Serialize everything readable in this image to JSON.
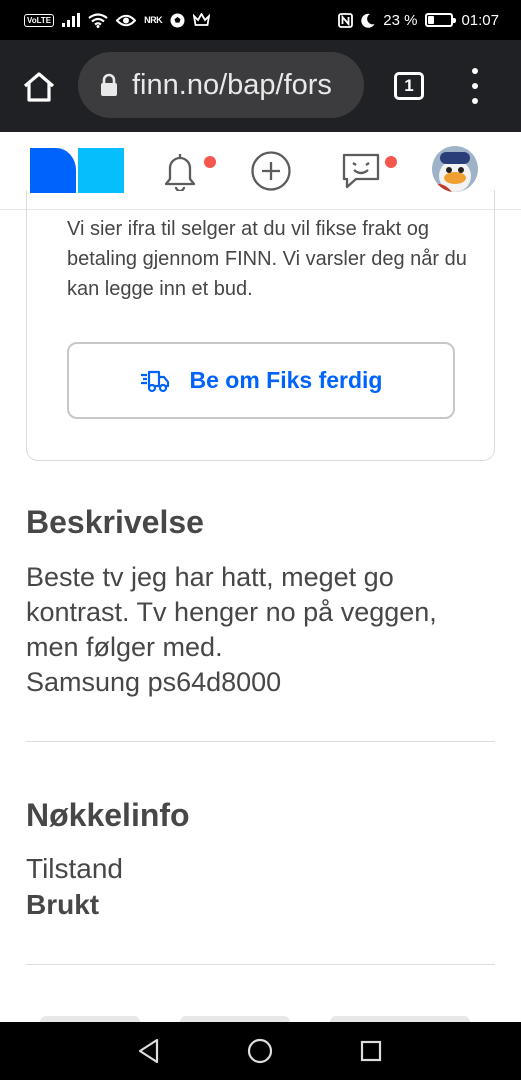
{
  "status_bar": {
    "volte": "VoLTE",
    "nrk": "NRK",
    "battery_percent": "23 %",
    "battery_level": 0.23,
    "time": "01:07"
  },
  "browser": {
    "url": "finn.no/bap/fors",
    "tab_count": "1"
  },
  "site_header": {
    "notifications_unread": true,
    "messages_unread": true
  },
  "fiks_card": {
    "text": "Vi sier ifra til selger at du vil fikse frakt og betaling gjennom FINN. Vi varsler deg når du kan legge inn et bud.",
    "button_label": "Be om Fiks ferdig"
  },
  "description": {
    "title": "Beskrivelse",
    "lines": [
      "Beste tv jeg har hatt, meget go",
      "kontrast. Tv henger no på veggen,",
      "men følger med.",
      "Samsung ps64d8000"
    ]
  },
  "key_info": {
    "title": "Nøkkelinfo",
    "label": "Tilstand",
    "value": "Brukt"
  },
  "colors": {
    "accent": "#0063fb",
    "notification_dot": "#f5574f",
    "logo_dark": "#0063fb",
    "logo_light": "#06befb"
  }
}
